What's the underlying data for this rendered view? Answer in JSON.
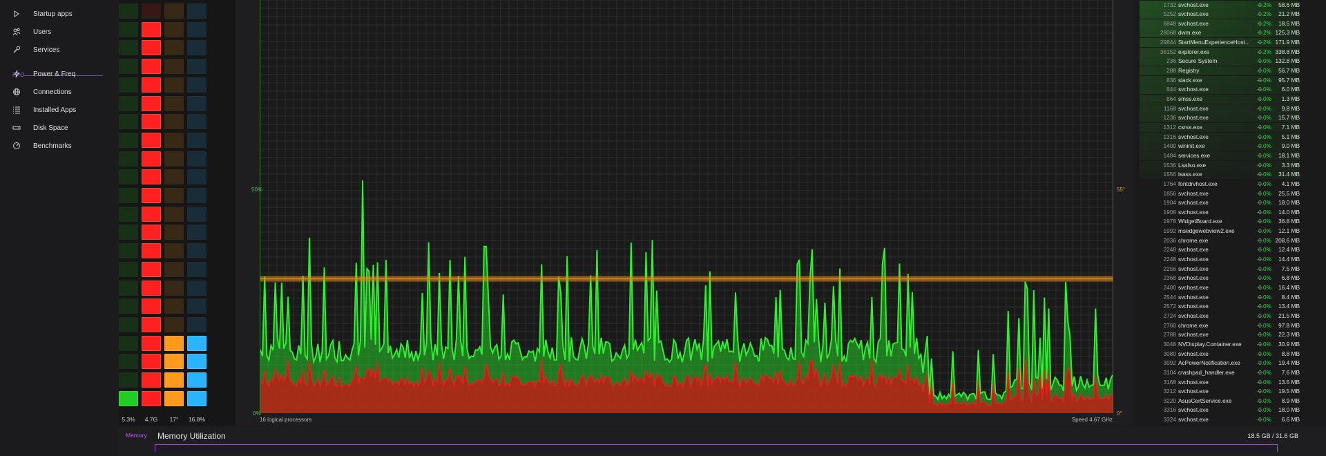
{
  "sidebar": {
    "items": [
      {
        "label": "Startup apps",
        "icon": "play-icon"
      },
      {
        "label": "Users",
        "icon": "users-icon"
      },
      {
        "label": "Services",
        "icon": "wrench-icon"
      },
      {
        "label": "Power & Freq",
        "icon": "lightning-icon"
      },
      {
        "label": "Connections",
        "icon": "globe-icon"
      },
      {
        "label": "Installed Apps",
        "icon": "list-icon"
      },
      {
        "label": "Disk Space",
        "icon": "disk-icon"
      },
      {
        "label": "Benchmarks",
        "icon": "gauge-icon"
      }
    ],
    "pro_label": "PRO"
  },
  "meters": [
    {
      "value_label": "5.3%",
      "level": 0.053,
      "color": "#22cc22"
    },
    {
      "value_label": "4.7G",
      "level": 0.94,
      "color": "#ff2020"
    },
    {
      "value_label": "17°",
      "level": 0.17,
      "color": "#ff9a1f"
    },
    {
      "value_label": "16.8%",
      "level": 0.168,
      "color": "#28b4ff"
    }
  ],
  "graph": {
    "left_mid_label": "50%",
    "left_bottom_label": "0%",
    "right_mid_label": "55°",
    "right_bottom_label": "0°",
    "footer_left": "16 logical processors",
    "footer_right": "Speed 4.67 GHz",
    "colors": {
      "total": "#2ff02f",
      "kernel": "#ee1c1c",
      "temperature": "#e08a18"
    }
  },
  "processes": [
    {
      "pid": "1732",
      "name": "svchost.exe",
      "cpu": "0.2%",
      "mem": "58.6 MB"
    },
    {
      "pid": "5252",
      "name": "svchost.exe",
      "cpu": "0.2%",
      "mem": "21.2 MB"
    },
    {
      "pid": "6848",
      "name": "svchost.exe",
      "cpu": "0.2%",
      "mem": "18.5 MB"
    },
    {
      "pid": "28068",
      "name": "dwm.exe",
      "cpu": "0.2%",
      "mem": "125.3 MB"
    },
    {
      "pid": "29844",
      "name": "StartMenuExperienceHost...",
      "cpu": "0.2%",
      "mem": "171.9 MB"
    },
    {
      "pid": "36152",
      "name": "explorer.exe",
      "cpu": "0.2%",
      "mem": "338.8 MB"
    },
    {
      "pid": "236",
      "name": "Secure System",
      "cpu": "0.0%",
      "mem": "132.8 MB"
    },
    {
      "pid": "288",
      "name": "Registry",
      "cpu": "0.0%",
      "mem": "56.7 MB"
    },
    {
      "pid": "836",
      "name": "slack.exe",
      "cpu": "0.0%",
      "mem": "95.7 MB"
    },
    {
      "pid": "844",
      "name": "svchost.exe",
      "cpu": "0.0%",
      "mem": "6.0 MB"
    },
    {
      "pid": "864",
      "name": "smss.exe",
      "cpu": "0.0%",
      "mem": "1.3 MB"
    },
    {
      "pid": "1168",
      "name": "svchost.exe",
      "cpu": "0.0%",
      "mem": "9.8 MB"
    },
    {
      "pid": "1236",
      "name": "svchost.exe",
      "cpu": "0.0%",
      "mem": "15.7 MB"
    },
    {
      "pid": "1312",
      "name": "csrss.exe",
      "cpu": "0.0%",
      "mem": "7.1 MB"
    },
    {
      "pid": "1316",
      "name": "svchost.exe",
      "cpu": "0.0%",
      "mem": "5.1 MB"
    },
    {
      "pid": "1400",
      "name": "wininit.exe",
      "cpu": "0.0%",
      "mem": "9.0 MB"
    },
    {
      "pid": "1484",
      "name": "services.exe",
      "cpu": "0.0%",
      "mem": "18.1 MB"
    },
    {
      "pid": "1536",
      "name": "LsaIso.exe",
      "cpu": "0.0%",
      "mem": "3.3 MB"
    },
    {
      "pid": "1556",
      "name": "lsass.exe",
      "cpu": "0.0%",
      "mem": "31.4 MB"
    },
    {
      "pid": "1764",
      "name": "fontdrvhost.exe",
      "cpu": "0.0%",
      "mem": "4.1 MB"
    },
    {
      "pid": "1856",
      "name": "svchost.exe",
      "cpu": "0.0%",
      "mem": "25.5 MB"
    },
    {
      "pid": "1904",
      "name": "svchost.exe",
      "cpu": "0.0%",
      "mem": "18.0 MB"
    },
    {
      "pid": "1908",
      "name": "svchost.exe",
      "cpu": "0.0%",
      "mem": "14.0 MB"
    },
    {
      "pid": "1978",
      "name": "WidgetBoard.exe",
      "cpu": "0.0%",
      "mem": "36.8 MB"
    },
    {
      "pid": "1992",
      "name": "msedgewebview2.exe",
      "cpu": "0.0%",
      "mem": "12.1 MB"
    },
    {
      "pid": "2036",
      "name": "chrome.exe",
      "cpu": "0.0%",
      "mem": "208.6 MB"
    },
    {
      "pid": "2248",
      "name": "svchost.exe",
      "cpu": "0.0%",
      "mem": "12.4 MB"
    },
    {
      "pid": "2248",
      "name": "svchost.exe",
      "cpu": "0.0%",
      "mem": "14.4 MB"
    },
    {
      "pid": "2256",
      "name": "svchost.exe",
      "cpu": "0.0%",
      "mem": "7.5 MB"
    },
    {
      "pid": "2368",
      "name": "svchost.exe",
      "cpu": "0.0%",
      "mem": "6.8 MB"
    },
    {
      "pid": "2400",
      "name": "svchost.exe",
      "cpu": "0.0%",
      "mem": "16.4 MB"
    },
    {
      "pid": "2544",
      "name": "svchost.exe",
      "cpu": "0.0%",
      "mem": "8.4 MB"
    },
    {
      "pid": "2572",
      "name": "svchost.exe",
      "cpu": "0.0%",
      "mem": "13.4 MB"
    },
    {
      "pid": "2724",
      "name": "svchost.exe",
      "cpu": "0.0%",
      "mem": "21.5 MB"
    },
    {
      "pid": "2760",
      "name": "chrome.exe",
      "cpu": "0.0%",
      "mem": "97.8 MB"
    },
    {
      "pid": "2788",
      "name": "svchost.exe",
      "cpu": "0.0%",
      "mem": "22.3 MB"
    },
    {
      "pid": "3048",
      "name": "NVDisplay.Container.exe",
      "cpu": "0.0%",
      "mem": "30.9 MB"
    },
    {
      "pid": "3080",
      "name": "svchost.exe",
      "cpu": "0.0%",
      "mem": "8.8 MB"
    },
    {
      "pid": "3092",
      "name": "AcPowerNotification.exe",
      "cpu": "0.0%",
      "mem": "19.4 MB"
    },
    {
      "pid": "3104",
      "name": "crashpad_handler.exe",
      "cpu": "0.0%",
      "mem": "7.6 MB"
    },
    {
      "pid": "3168",
      "name": "svchost.exe",
      "cpu": "0.0%",
      "mem": "13.5 MB"
    },
    {
      "pid": "3212",
      "name": "svchost.exe",
      "cpu": "0.0%",
      "mem": "19.5 MB"
    },
    {
      "pid": "3220",
      "name": "AsusCertService.exe",
      "cpu": "0.0%",
      "mem": "8.9 MB"
    },
    {
      "pid": "3316",
      "name": "svchost.exe",
      "cpu": "0.0%",
      "mem": "18.0 MB"
    },
    {
      "pid": "3324",
      "name": "svchost.exe",
      "cpu": "0.0%",
      "mem": "6.6 MB"
    }
  ],
  "process_dash": "—",
  "memory": {
    "tag": "Memory",
    "title": "Memory Utilization",
    "total": "18.5 GB / 31.6 GB"
  }
}
